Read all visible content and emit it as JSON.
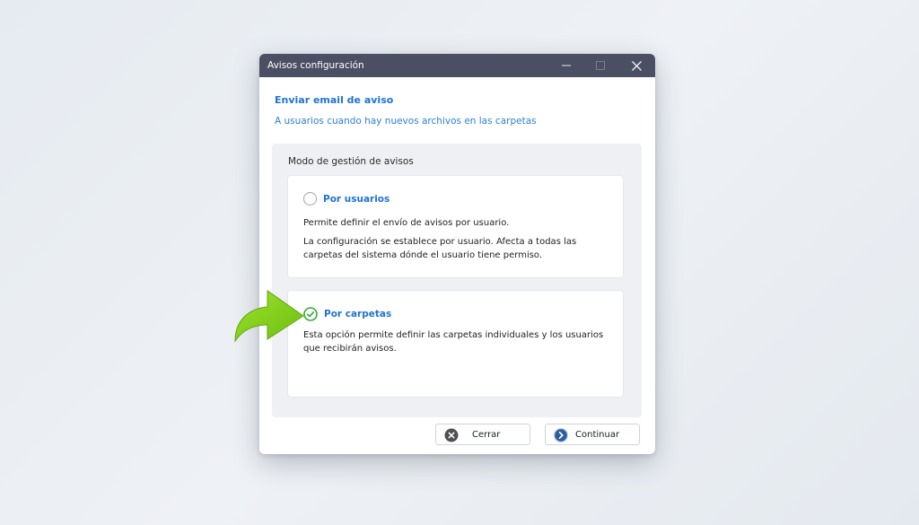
{
  "window": {
    "title": "Avisos configuración"
  },
  "header": {
    "title": "Enviar email de aviso",
    "subtitle": "A usuarios cuando hay nuevos archivos en las carpetas"
  },
  "group": {
    "label": "Modo de gestión de avisos",
    "options": [
      {
        "title": "Por usuarios",
        "selected": false,
        "desc1": "Permite definir el envío de avisos por usuario.",
        "desc2": "La configuración se establece por usuario. Afecta a todas las carpetas del sistema dónde el usuario tiene permiso."
      },
      {
        "title": "Por carpetas",
        "selected": true,
        "desc1": "Esta opción permite definir las carpetas individuales y los usuarios que recibirán avisos."
      }
    ]
  },
  "buttons": {
    "cerrar": "Cerrar",
    "continuar": "Continuar"
  },
  "colors": {
    "titlebar": "#4a4f63",
    "accent": "#1f73d1",
    "selected_green": "#35a835",
    "annotation_arrow": "#86d11c"
  },
  "icons": {
    "minimize": "minimize-icon",
    "maximize": "maximize-icon",
    "close": "close-icon",
    "cerrar": "close-circle-icon",
    "continuar": "arrow-right-circle-icon",
    "annotation": "pointer-arrow-icon"
  }
}
